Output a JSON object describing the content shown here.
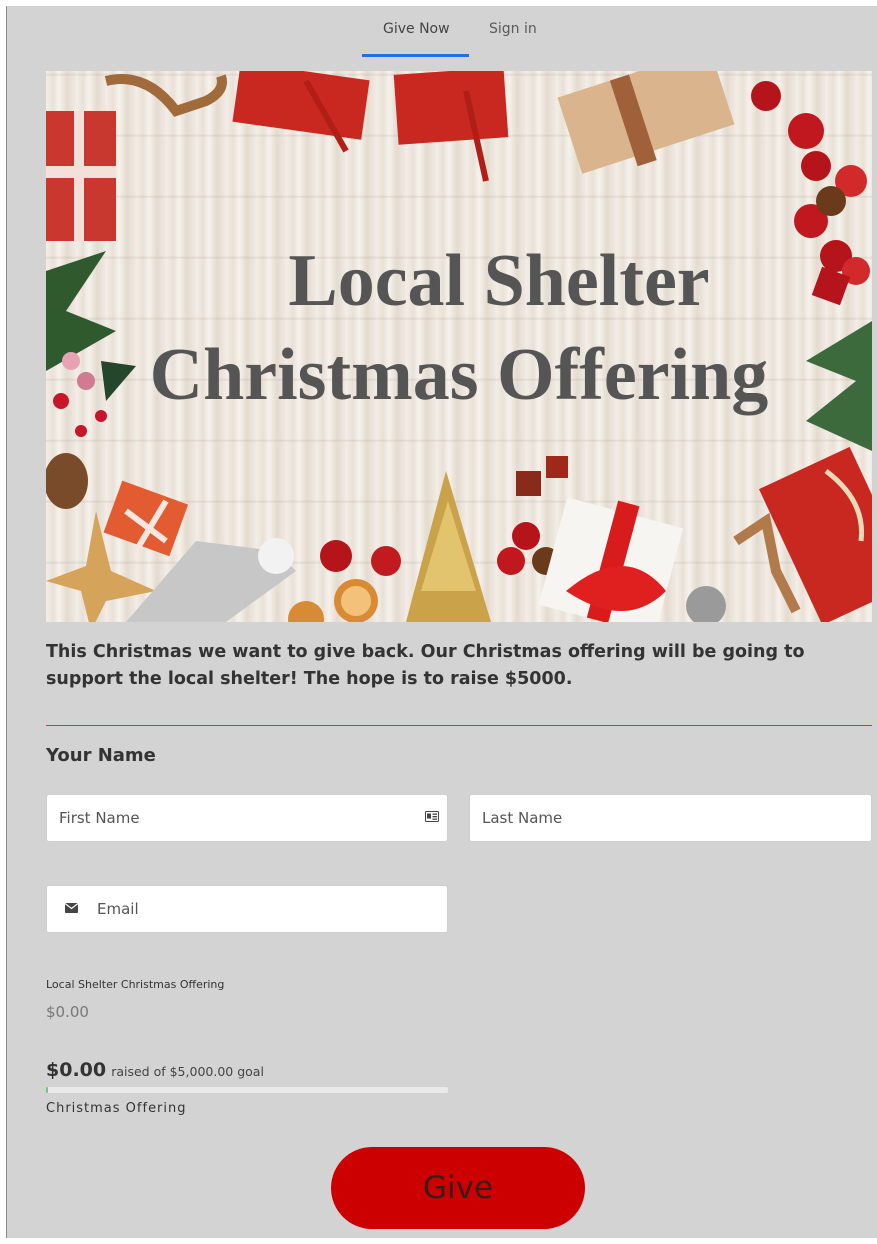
{
  "nav": {
    "tabs": [
      {
        "label": "Give Now",
        "active": true
      },
      {
        "label": "Sign in",
        "active": false
      }
    ],
    "accent_color": "#1a73e8"
  },
  "hero": {
    "title_line1": "Local Shelter",
    "title_line2": "Christmas Offering"
  },
  "intro_text": "This Christmas we want to give back. Our Christmas offering will be going to support the local shelter! The hope is to raise $5000.",
  "form": {
    "section_label": "Your Name",
    "first_name": {
      "placeholder": "First Name",
      "icon": "contact-card-icon"
    },
    "last_name": {
      "placeholder": "Last Name"
    },
    "email": {
      "placeholder": "Email",
      "icon": "envelope-icon"
    }
  },
  "fund": {
    "name": "Local Shelter Christmas Offering",
    "amount": "$0.00"
  },
  "progress": {
    "raised_amount": "$0.00",
    "raised_text": "raised of $5,000.00 goal",
    "fraction": 0.005,
    "campaign_label": "Christmas Offering"
  },
  "give_button": {
    "label": "Give",
    "color": "#cc0000"
  }
}
